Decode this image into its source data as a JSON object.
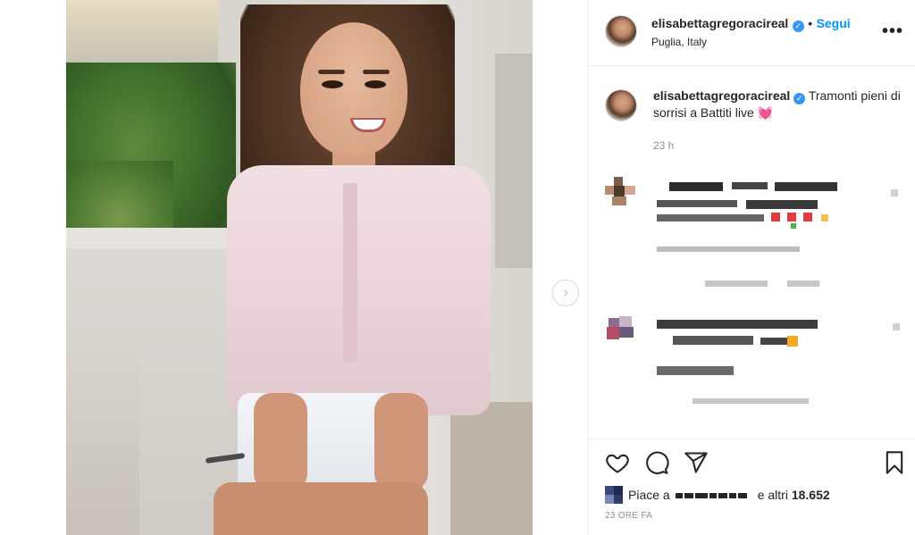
{
  "post": {
    "username": "elisabettagregoracireal",
    "follow_label": "Segui",
    "separator": "•",
    "location": "Puglia, Italy",
    "more_icon": "•••",
    "next_arrow": "›"
  },
  "caption": {
    "username": "elisabettagregoracireal",
    "text": "Tramonti pieni di sorrisi a Battiti live",
    "emoji": "💓",
    "time": "23 h"
  },
  "likes": {
    "prefix": "Piace a",
    "suffix": "e altri",
    "count": "18.652"
  },
  "post_time": "23 ORE FA",
  "icons": {
    "heart": "heart-icon",
    "comment": "comment-icon",
    "share": "share-icon",
    "save": "bookmark-icon",
    "verified": "verified-badge-icon"
  },
  "colors": {
    "follow": "#0095f6",
    "verified": "#3897f0",
    "muted": "#8e8e8e",
    "text": "#262626"
  }
}
